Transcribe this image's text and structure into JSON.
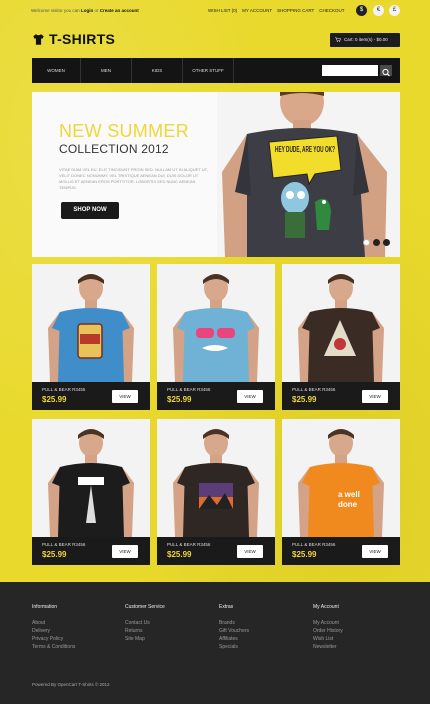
{
  "topbar": {
    "welcome_text": "Welcome visitor you can",
    "login_label": "Login",
    "or_text": "or",
    "create_label": "Create an account",
    "links": [
      "Wish List (0)",
      "My Account",
      "Shopping Cart",
      "Checkout"
    ],
    "circle_1": "$",
    "circle_2": "€",
    "circle_3": "£"
  },
  "header": {
    "logo_text": "T-SHIRTS",
    "cart_text": "Cart: 0 item(s) - $0.00"
  },
  "nav": {
    "items": [
      "Women",
      "Men",
      "Kids",
      "Other Stuff"
    ],
    "search_placeholder": ""
  },
  "hero": {
    "title_line1": "NEW SUMMER",
    "title_line2": "COLLECTION 2012",
    "body_text": "Vitae diam vel eu, elit tincidunt proin sed. Nullam ut in aliquet ut, velit donec nonummy, vel tristique aenean dui. Duis dolor ut mollis et aenean eros porttitor. Lobortis sed nunc aenean tempus.",
    "button_label": "SHOP NOW",
    "shirt_text": "HEY DUDE, ARE YOU OK?",
    "colors": {
      "accent": "#f0d53a",
      "dark": "#1a1a1a"
    }
  },
  "products": [
    {
      "name": "Pull & Bear R3455",
      "price": "$25.99",
      "view_label": "VIEW",
      "shirt_color": "#3f8ec9",
      "print": "can"
    },
    {
      "name": "Pull & Bear R3456",
      "price": "$25.99",
      "view_label": "VIEW",
      "shirt_color": "#6fb2d6",
      "print": "glasses"
    },
    {
      "name": "Pull & Bear R3456",
      "price": "$25.99",
      "view_label": "VIEW",
      "shirt_color": "#3a2b25",
      "print": "triangle"
    },
    {
      "name": "Pull & Bear R3456",
      "price": "$25.99",
      "view_label": "VIEW",
      "shirt_color": "#1c1c1c",
      "print": "paris"
    },
    {
      "name": "Pull & Bear R3456",
      "price": "$25.99",
      "view_label": "VIEW",
      "shirt_color": "#2e2724",
      "print": "sunset"
    },
    {
      "name": "Pull & Bear R3456",
      "price": "$25.99",
      "view_label": "VIEW",
      "shirt_color": "#f08a1e",
      "print": "text"
    }
  ],
  "footer": {
    "columns": [
      {
        "title": "Information",
        "links": [
          "About",
          "Delivery",
          "Privacy Policy",
          "Terms & Conditions"
        ]
      },
      {
        "title": "Customer Service",
        "links": [
          "Contact Us",
          "Returns",
          "Site Map"
        ]
      },
      {
        "title": "Extras",
        "links": [
          "Brands",
          "Gift Vouchers",
          "Affiliates",
          "Specials"
        ]
      },
      {
        "title": "My Account",
        "links": [
          "My Account",
          "Order History",
          "Wish List",
          "Newsletter"
        ]
      }
    ],
    "copyright": "Powered By OpenCart T-Shirts © 2012"
  }
}
